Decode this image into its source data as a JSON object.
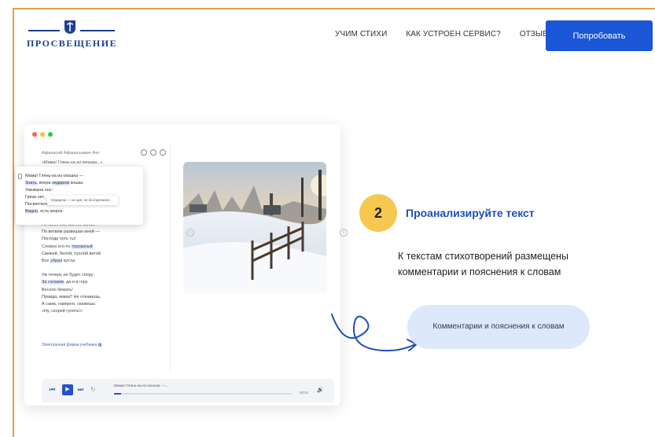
{
  "brand": {
    "logo_text": "ПРОСВЕЩЕНИЕ",
    "color": "#1e3f8e"
  },
  "nav": {
    "items": [
      {
        "label": "УЧИМ СТИХИ"
      },
      {
        "label": "КАК УСТРОЕН СЕРВИС?"
      },
      {
        "label": "ОТЗЫВЫ"
      }
    ],
    "cta_label": "Попробовать",
    "cta_color": "#1a56d6"
  },
  "app": {
    "poem_author": "Афанасий Афанасьевич Фет",
    "poem_title": "«Мама! Глянь-ка из окошка...»",
    "popup_lines": [
      "Мама! Глянь-ка из окошка —",
      "Знать, вчера недаром кошка",
      "Умывала нос:",
      "Грязи нет,",
      "Посветлело, побелело —",
      "Видно, есть мороз."
    ],
    "tooltip": "Недаром — не зря, не беспричинно",
    "poem_lines": [
      "Не колючий, светло-синий",
      "По ветвям развешан иней —",
      "Погляди хоть ты!",
      "Словно кто-то тороватый",
      "Свежей, белой, пухлой ватой",
      "Все убрал кусты."
    ],
    "poem_lines2": [
      "Уж теперь не будет спору:",
      "За салазки, да и в гору",
      "Весело бежать!",
      "Правда, мама? Не откажешь,",
      "А сама, наверно, скажешь:",
      "«Ну, скорей гулять!»"
    ],
    "ebook_label": "Электронная форма учебника",
    "player": {
      "title": "Мама! Глянь-ка из окошка —...",
      "time": "00:01",
      "progress": 0.04
    }
  },
  "step": {
    "number": "2",
    "title": "Проанализируйте текст",
    "description": "К текстам стихотворений размещены комментарии и пояснения к словам",
    "pill_label": "Комментарии и пояснения к словам",
    "accent": "#f5c94f",
    "pill_color": "#dde9fb"
  }
}
